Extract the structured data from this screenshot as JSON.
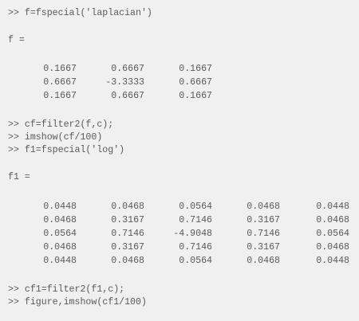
{
  "console": {
    "cmd1": ">> f=fspecial('laplacian')",
    "var_f": "f =",
    "matrix_f": [
      [
        "0.1667",
        "0.6667",
        "0.1667"
      ],
      [
        "0.6667",
        "-3.3333",
        "0.6667"
      ],
      [
        "0.1667",
        "0.6667",
        "0.1667"
      ]
    ],
    "cmd2": ">> cf=filter2(f,c);",
    "cmd3": ">> imshow(cf/100)",
    "cmd4": ">> f1=fspecial('log')",
    "var_f1": "f1 =",
    "matrix_f1": [
      [
        "0.0448",
        "0.0468",
        "0.0564",
        "0.0468",
        "0.0448"
      ],
      [
        "0.0468",
        "0.3167",
        "0.7146",
        "0.3167",
        "0.0468"
      ],
      [
        "0.0564",
        "0.7146",
        "-4.9048",
        "0.7146",
        "0.0564"
      ],
      [
        "0.0468",
        "0.3167",
        "0.7146",
        "0.3167",
        "0.0468"
      ],
      [
        "0.0448",
        "0.0468",
        "0.0564",
        "0.0468",
        "0.0448"
      ]
    ],
    "cmd5": ">> cf1=filter2(f1,c);",
    "cmd6": ">> figure,imshow(cf1/100)"
  }
}
